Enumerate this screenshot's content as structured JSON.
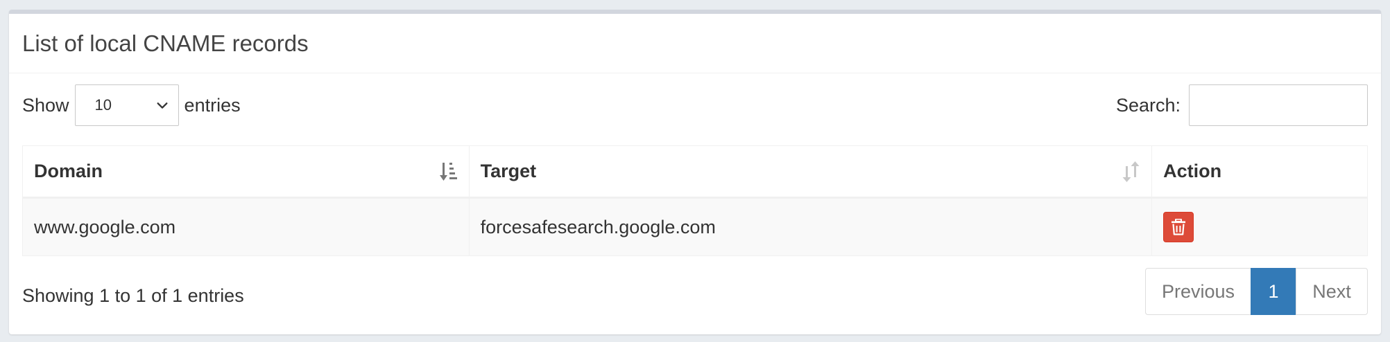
{
  "box": {
    "title": "List of local CNAME records"
  },
  "controls": {
    "show_label": "Show",
    "entries_label": "entries",
    "page_length": "10",
    "search_label": "Search:",
    "search_value": ""
  },
  "table": {
    "columns": [
      "Domain",
      "Target",
      "Action"
    ],
    "rows": [
      {
        "domain": "www.google.com",
        "target": "forcesafesearch.google.com"
      }
    ]
  },
  "footer": {
    "info": "Showing 1 to 1 of 1 entries",
    "previous": "Previous",
    "current_page": "1",
    "next": "Next"
  },
  "icons": {
    "sort_domain": "sort-amount-asc-icon",
    "sort_target": "sort-both-icon",
    "delete": "trash-icon",
    "select": "chevron-down-icon"
  },
  "colors": {
    "delete_button": "#dd4b39",
    "active_page": "#337ab7",
    "box_border": "#d2d6de"
  }
}
